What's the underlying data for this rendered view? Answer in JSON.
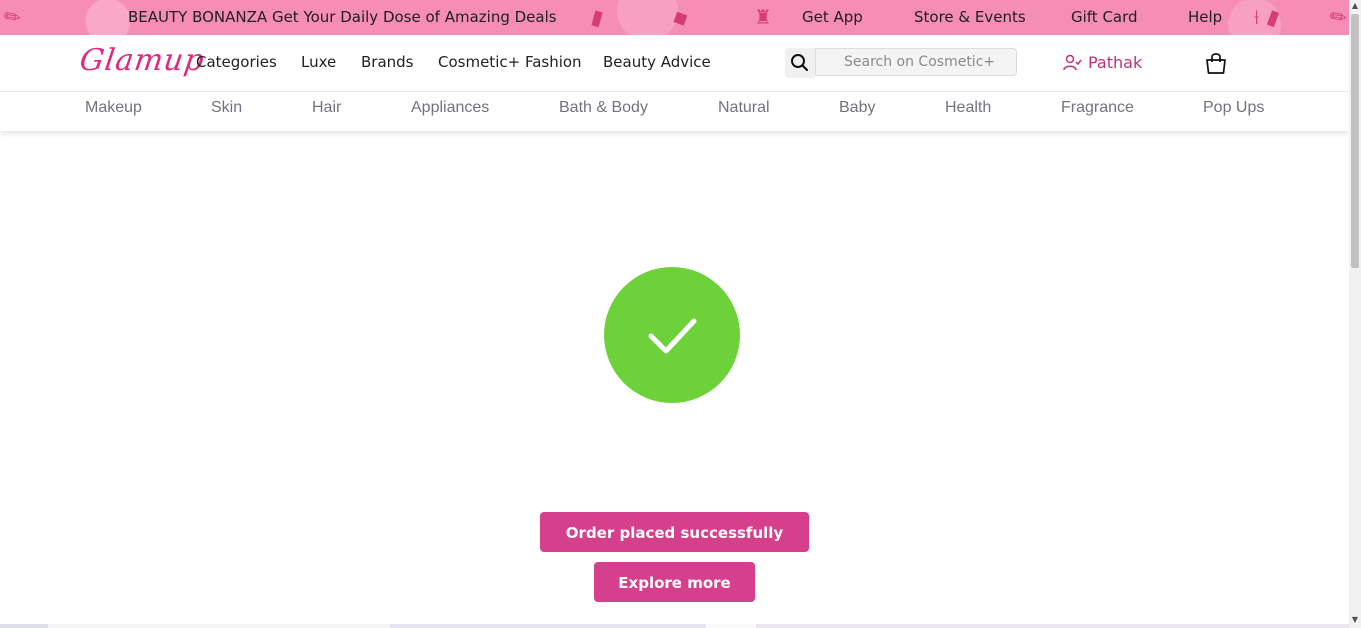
{
  "promo": {
    "title": "BEAUTY BONANZA Get Your Daily Dose of Amazing Deals",
    "links": [
      "Get App",
      "Store & Events",
      "Gift Card",
      "Help"
    ]
  },
  "header": {
    "logo": "Glamup",
    "nav": [
      "Categories",
      "Luxe",
      "Brands",
      "Cosmetic+ Fashion",
      "Beauty Advice"
    ],
    "search_placeholder": "Search on Cosmetic+",
    "user_name": "Pathak"
  },
  "categories": [
    "Makeup",
    "Skin",
    "Hair",
    "Appliances",
    "Bath & Body",
    "Natural",
    "Baby",
    "Health",
    "Fragrance",
    "Pop Ups"
  ],
  "confirmation": {
    "order_button": "Order placed successfully",
    "explore_button": "Explore more"
  },
  "colors": {
    "promo_bg": "#f58db4",
    "brand": "#e0287d",
    "button": "#d63f8c",
    "success": "#6dd23a"
  },
  "icons": {
    "search": "search-icon",
    "user": "user-check-icon",
    "cart": "shopping-bag-icon",
    "success": "checkmark-icon"
  }
}
